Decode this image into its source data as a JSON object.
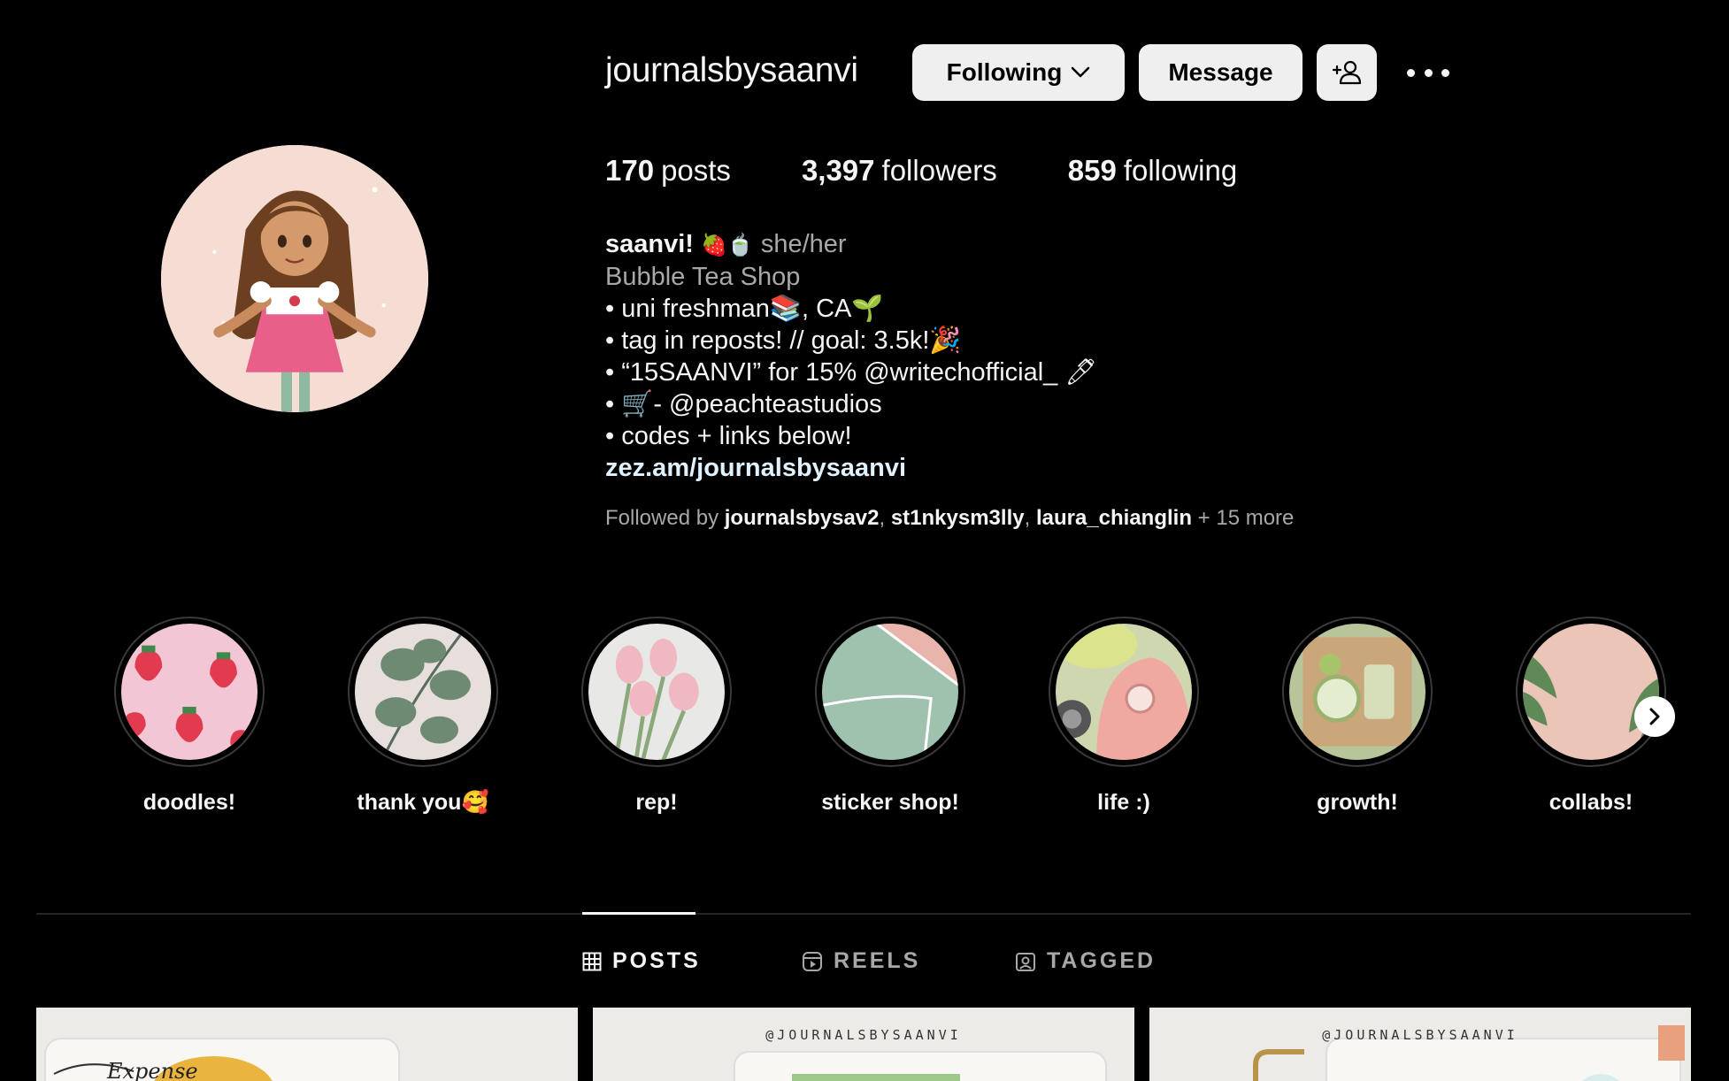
{
  "profile": {
    "username": "journalsbysaanvi",
    "following_button": "Following",
    "message_button": "Message",
    "stats": {
      "posts_count": "170",
      "posts_label": "posts",
      "followers_count": "3,397",
      "followers_label": "followers",
      "following_count": "859",
      "following_label": "following"
    },
    "bio": {
      "name": "saanvi!",
      "name_emojis": "🍓🍵",
      "pronouns": "she/her",
      "category": "Bubble Tea Shop",
      "line1": "• uni freshman📚, CA🌱",
      "line2": "• tag in reposts! // goal: 3.5k!🎉",
      "line3": "• “15SAANVI” for 15% @writechofficial_ 🖊",
      "line4": "• 🛒- @peachteastudios",
      "line5": "• codes + links below!",
      "link": "zez.am/journalsbysaanvi"
    },
    "followed_by": {
      "prefix": "Followed by",
      "user1": "journalsbysav2",
      "user2": "st1nkysm3lly",
      "user3": "laura_chianglin",
      "more": "+ 15 more"
    }
  },
  "highlights": [
    {
      "label": "doodles!"
    },
    {
      "label": "thank you🥰"
    },
    {
      "label": "rep!"
    },
    {
      "label": "sticker shop!"
    },
    {
      "label": "life :)"
    },
    {
      "label": "growth!"
    },
    {
      "label": "collabs!"
    }
  ],
  "tabs": {
    "posts": "POSTS",
    "reels": "REELS",
    "tagged": "TAGGED",
    "active": "posts"
  },
  "posts": [
    {
      "overlay_text": "Expense"
    },
    {
      "overlay_text": "@JOURNALSBYSAANVI"
    },
    {
      "overlay_text": "@JOURNALSBYSAANVI"
    }
  ],
  "colors": {
    "background": "#000000",
    "button_bg": "#efefef",
    "text_primary": "#f5f5f5",
    "text_secondary": "#a8a8a8",
    "link": "#e0f1ff"
  }
}
